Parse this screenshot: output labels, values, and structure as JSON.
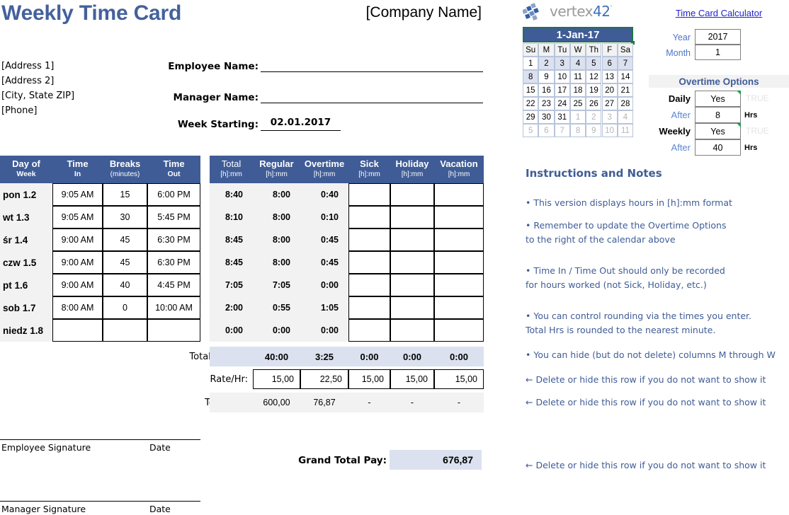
{
  "header": {
    "title": "Weekly Time Card",
    "company": "[Company Name]"
  },
  "address": [
    "[Address 1]",
    "[Address 2]",
    "[City, State  ZIP]",
    "[Phone]"
  ],
  "fields": {
    "employee_label": "Employee Name:",
    "employee_value": "",
    "manager_label": "Manager Name:",
    "manager_value": "",
    "week_label": "Week Starting:",
    "week_value": "02.01.2017"
  },
  "left_table": {
    "headers": [
      {
        "line1": "Day of",
        "line2": "Week",
        "sub": ""
      },
      {
        "line1": "Time",
        "line2": "In",
        "sub": ""
      },
      {
        "line1": "Breaks",
        "line2": "",
        "sub": "(minutes)"
      },
      {
        "line1": "Time",
        "line2": "Out",
        "sub": ""
      }
    ],
    "rows": [
      {
        "day": "pon 1.2",
        "in": "9:05 AM",
        "breaks": "15",
        "out": "6:00 PM"
      },
      {
        "day": "wt 1.3",
        "in": "9:05 AM",
        "breaks": "30",
        "out": "5:45 PM"
      },
      {
        "day": "śr 1.4",
        "in": "9:00 AM",
        "breaks": "45",
        "out": "6:30 PM"
      },
      {
        "day": "czw 1.5",
        "in": "9:00 AM",
        "breaks": "45",
        "out": "6:30 PM"
      },
      {
        "day": "pt 1.6",
        "in": "9:00 AM",
        "breaks": "40",
        "out": "4:45 PM"
      },
      {
        "day": "sob 1.7",
        "in": "8:00 AM",
        "breaks": "0",
        "out": "10:00 AM"
      },
      {
        "day": "niedz 1.8",
        "in": "",
        "breaks": "",
        "out": ""
      }
    ]
  },
  "right_table": {
    "headers": [
      {
        "name": "Total",
        "sub": "[h]:mm",
        "bold": false
      },
      {
        "name": "Regular",
        "sub": "[h]:mm",
        "bold": true
      },
      {
        "name": "Overtime",
        "sub": "[h]:mm",
        "bold": true
      },
      {
        "name": "Sick",
        "sub": "[h]:mm",
        "bold": true
      },
      {
        "name": "Holiday",
        "sub": "[h]:mm",
        "bold": true
      },
      {
        "name": "Vacation",
        "sub": "[h]:mm",
        "bold": true
      }
    ],
    "rows": [
      {
        "total": "8:40",
        "regular": "8:00",
        "overtime": "0:40",
        "sick": "",
        "holiday": "",
        "vacation": ""
      },
      {
        "total": "8:10",
        "regular": "8:00",
        "overtime": "0:10",
        "sick": "",
        "holiday": "",
        "vacation": ""
      },
      {
        "total": "8:45",
        "regular": "8:00",
        "overtime": "0:45",
        "sick": "",
        "holiday": "",
        "vacation": ""
      },
      {
        "total": "8:45",
        "regular": "8:00",
        "overtime": "0:45",
        "sick": "",
        "holiday": "",
        "vacation": ""
      },
      {
        "total": "7:05",
        "regular": "7:05",
        "overtime": "0:00",
        "sick": "",
        "holiday": "",
        "vacation": ""
      },
      {
        "total": "2:00",
        "regular": "0:55",
        "overtime": "1:05",
        "sick": "",
        "holiday": "",
        "vacation": ""
      },
      {
        "total": "0:00",
        "regular": "0:00",
        "overtime": "0:00",
        "sick": "",
        "holiday": "",
        "vacation": ""
      }
    ],
    "total_label": "Total [h]:mm",
    "totals": [
      "40:00",
      "3:25",
      "0:00",
      "0:00",
      "0:00"
    ],
    "rate_label": "Rate/Hr:",
    "rates": [
      "15,00",
      "22,50",
      "15,00",
      "15,00",
      "15,00"
    ],
    "pay_label": "Total Pay:",
    "pays": [
      "600,00",
      "76,87",
      "-",
      "-",
      "-"
    ]
  },
  "signatures": {
    "employee": "Employee Signature",
    "employee_date": "Date",
    "manager": "Manager Signature",
    "manager_date": "Date"
  },
  "grand_total": {
    "label": "Grand Total Pay:",
    "value": "676,87"
  },
  "sidebar": {
    "logo_gray": "vertex",
    "logo_blue": "42",
    "logo_dot": "·",
    "calc_link": "Time Card Calculator",
    "year_label": "Year",
    "year_value": "2017",
    "month_label": "Month",
    "month_value": "1"
  },
  "calendar": {
    "title": "1-Jan-17",
    "dow": [
      "Su",
      "M",
      "Tu",
      "W",
      "Th",
      "F",
      "Sa"
    ],
    "weeks": [
      [
        {
          "d": "1",
          "s": "n"
        },
        {
          "d": "2",
          "s": "h"
        },
        {
          "d": "3",
          "s": "h"
        },
        {
          "d": "4",
          "s": "h"
        },
        {
          "d": "5",
          "s": "h"
        },
        {
          "d": "6",
          "s": "h"
        },
        {
          "d": "7",
          "s": "h"
        }
      ],
      [
        {
          "d": "8",
          "s": "h"
        },
        {
          "d": "9",
          "s": "n"
        },
        {
          "d": "10",
          "s": "n"
        },
        {
          "d": "11",
          "s": "n"
        },
        {
          "d": "12",
          "s": "n"
        },
        {
          "d": "13",
          "s": "n"
        },
        {
          "d": "14",
          "s": "n"
        }
      ],
      [
        {
          "d": "15",
          "s": "n"
        },
        {
          "d": "16",
          "s": "n"
        },
        {
          "d": "17",
          "s": "n"
        },
        {
          "d": "18",
          "s": "n"
        },
        {
          "d": "19",
          "s": "n"
        },
        {
          "d": "20",
          "s": "n"
        },
        {
          "d": "21",
          "s": "n"
        }
      ],
      [
        {
          "d": "22",
          "s": "n"
        },
        {
          "d": "23",
          "s": "n"
        },
        {
          "d": "24",
          "s": "n"
        },
        {
          "d": "25",
          "s": "n"
        },
        {
          "d": "26",
          "s": "n"
        },
        {
          "d": "27",
          "s": "n"
        },
        {
          "d": "28",
          "s": "n"
        }
      ],
      [
        {
          "d": "29",
          "s": "n"
        },
        {
          "d": "30",
          "s": "n"
        },
        {
          "d": "31",
          "s": "n"
        },
        {
          "d": "1",
          "s": "d"
        },
        {
          "d": "2",
          "s": "d"
        },
        {
          "d": "3",
          "s": "d"
        },
        {
          "d": "4",
          "s": "d"
        }
      ],
      [
        {
          "d": "5",
          "s": "d"
        },
        {
          "d": "6",
          "s": "d"
        },
        {
          "d": "7",
          "s": "d"
        },
        {
          "d": "8",
          "s": "d"
        },
        {
          "d": "9",
          "s": "d"
        },
        {
          "d": "10",
          "s": "d"
        },
        {
          "d": "11",
          "s": "d"
        }
      ]
    ]
  },
  "overtime": {
    "title": "Overtime Options",
    "rows": [
      {
        "label": "Daily",
        "bold": true,
        "value": "Yes",
        "unit": "",
        "flag": "TRUE"
      },
      {
        "label": "After",
        "bold": false,
        "value": "8",
        "unit": "Hrs",
        "flag": ""
      },
      {
        "label": "Weekly",
        "bold": true,
        "value": "Yes",
        "unit": "",
        "flag": "TRUE"
      },
      {
        "label": "After",
        "bold": false,
        "value": "40",
        "unit": "Hrs",
        "flag": ""
      }
    ]
  },
  "instructions": {
    "title": "Instructions and Notes",
    "notes": [
      {
        "lines": [
          "• This version displays hours in [h]:mm format"
        ]
      },
      {
        "lines": [
          "• Remember to update the Overtime Options",
          "to the right of the calendar above"
        ]
      },
      {
        "lines": [
          "• Time In / Time Out should only be recorded",
          "for hours worked (not Sick, Holiday, etc.)"
        ]
      },
      {
        "lines": [
          "• You can control rounding via the times you enter.",
          "Total Hrs is rounded to the nearest minute."
        ]
      },
      {
        "lines": [
          "• You can hide (but do not delete) columns M through W"
        ]
      }
    ],
    "delete_notes": [
      "← Delete or hide this row if you do not want to show it",
      "← Delete or hide this row if you do not want to show it",
      "← Delete or hide this row if you do not want to show it"
    ]
  },
  "colors": {
    "brand_blue": "#3f5c96",
    "title_blue": "#44619c",
    "highlight": "#dbe1ef",
    "gray_fill": "#f2f2f2",
    "link": "#2222cc",
    "select_green": "#217346"
  }
}
